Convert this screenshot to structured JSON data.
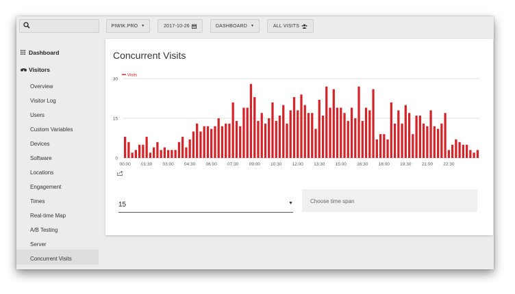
{
  "toolbar": {
    "site_label": "PIWIK.PRO",
    "date_label": "2017-10-26",
    "dashboard_label": "DASHBOARD",
    "segment_label": "ALL VISITS"
  },
  "sidebar": {
    "dashboard_label": "Dashboard",
    "visitors_label": "Visitors",
    "items": [
      {
        "label": "Overview"
      },
      {
        "label": "Visitor Log"
      },
      {
        "label": "Users"
      },
      {
        "label": "Custom Variables"
      },
      {
        "label": "Devices"
      },
      {
        "label": "Software"
      },
      {
        "label": "Locations"
      },
      {
        "label": "Engagement"
      },
      {
        "label": "Times"
      },
      {
        "label": "Real-time Map"
      },
      {
        "label": "A/B Testing"
      },
      {
        "label": "Server"
      },
      {
        "label": "Concurrent Visits"
      }
    ],
    "active_item": "Concurrent Visits"
  },
  "panel": {
    "title": "Concurrent Visits",
    "select_value": "15",
    "timespan_placeholder": "Choose time span"
  },
  "colors": {
    "bar": "#d3242a",
    "background": "#ececec"
  },
  "chart_data": {
    "type": "bar",
    "legend": "Visits",
    "legend_position": "top-left",
    "ylim": [
      0,
      30
    ],
    "y_ticks": [
      "0",
      "15",
      "30"
    ],
    "x_tick_labels": [
      "00:00",
      "01:30",
      "03:00",
      "04:30",
      "06:00",
      "07:30",
      "09:00",
      "10:30",
      "12:00",
      "13:30",
      "15:00",
      "16:30",
      "18:00",
      "19:30",
      "21:00",
      "22:30"
    ],
    "x_tick_every": 6,
    "x_start": "00:00",
    "interval_minutes": 15,
    "series": [
      {
        "name": "Visits",
        "values": [
          8,
          6,
          2,
          3,
          5,
          5,
          8,
          2,
          4,
          6,
          3,
          4,
          3,
          3,
          3,
          6,
          8,
          4,
          7,
          10,
          13,
          10,
          12,
          12,
          11,
          12,
          15,
          12,
          13,
          13,
          21,
          14,
          12,
          19,
          19,
          28,
          23,
          14,
          17,
          13,
          15,
          21,
          14,
          16,
          20,
          13,
          18,
          23,
          18,
          24,
          20,
          17,
          17,
          11,
          22,
          16,
          27,
          19,
          26,
          19,
          19,
          17,
          14,
          19,
          15,
          27,
          14,
          19,
          18,
          26,
          7,
          9,
          9,
          7,
          21,
          13,
          18,
          13,
          20,
          17,
          9,
          16,
          16,
          13,
          12,
          18,
          12,
          11,
          13,
          17,
          3,
          5,
          7,
          6,
          5,
          5,
          3,
          2,
          3
        ]
      }
    ]
  }
}
